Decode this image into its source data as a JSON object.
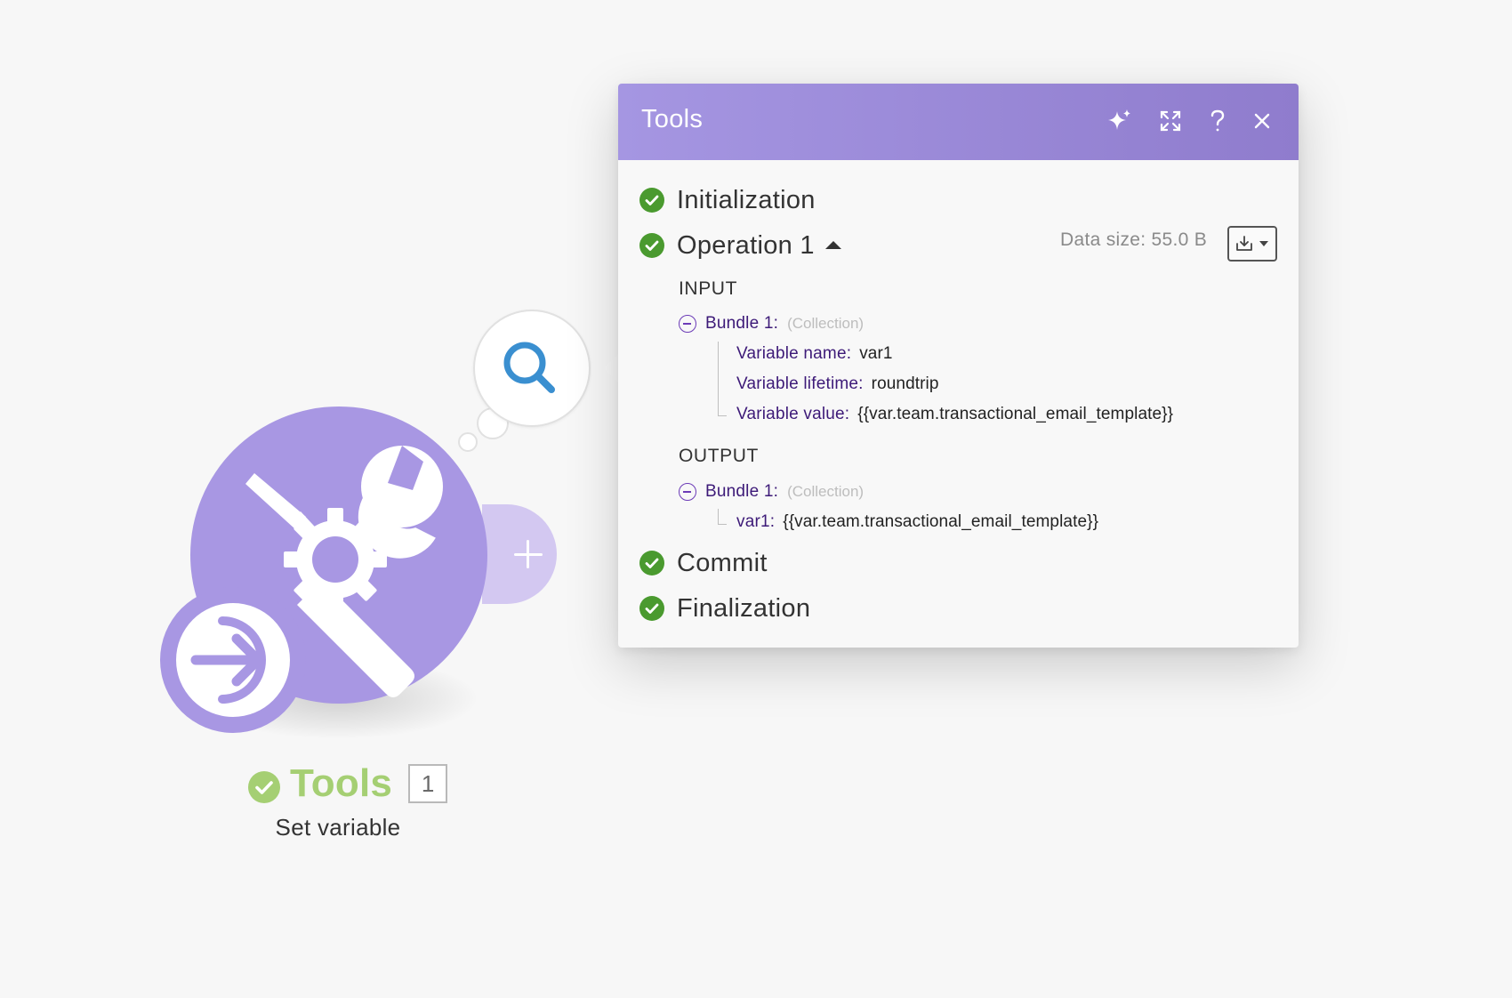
{
  "panel": {
    "title": "Tools",
    "header_icons": [
      "sparkle-icon",
      "expand-icon",
      "help-icon",
      "close-icon"
    ],
    "phases": {
      "initialization": "Initialization",
      "operation": "Operation 1",
      "commit": "Commit",
      "finalization": "Finalization"
    },
    "data_size": "Data size: 55.0 B",
    "input": {
      "heading": "INPUT",
      "bundle_label": "Bundle 1:",
      "bundle_type": "(Collection)",
      "fields": [
        {
          "key": "Variable name:",
          "value": "var1"
        },
        {
          "key": "Variable lifetime:",
          "value": "roundtrip"
        },
        {
          "key": "Variable value:",
          "value": "{{var.team.transactional_email_template}}"
        }
      ]
    },
    "output": {
      "heading": "OUTPUT",
      "bundle_label": "Bundle 1:",
      "bundle_type": "(Collection)",
      "fields": [
        {
          "key": "var1:",
          "value": "{{var.team.transactional_email_template}}"
        }
      ]
    }
  },
  "module": {
    "title": "Tools",
    "operations_count": "1",
    "subtitle": "Set variable",
    "icons": [
      "tools-icon",
      "trigger-icon",
      "search-icon",
      "plus-icon"
    ]
  },
  "colors": {
    "brand_purple": "#a897e3",
    "header_gradient_start": "#a596e2",
    "header_gradient_end": "#8f7ccd",
    "success_green": "#4a9a2f",
    "module_title_green": "#a5cf73",
    "key_purple": "#3d1a78"
  }
}
